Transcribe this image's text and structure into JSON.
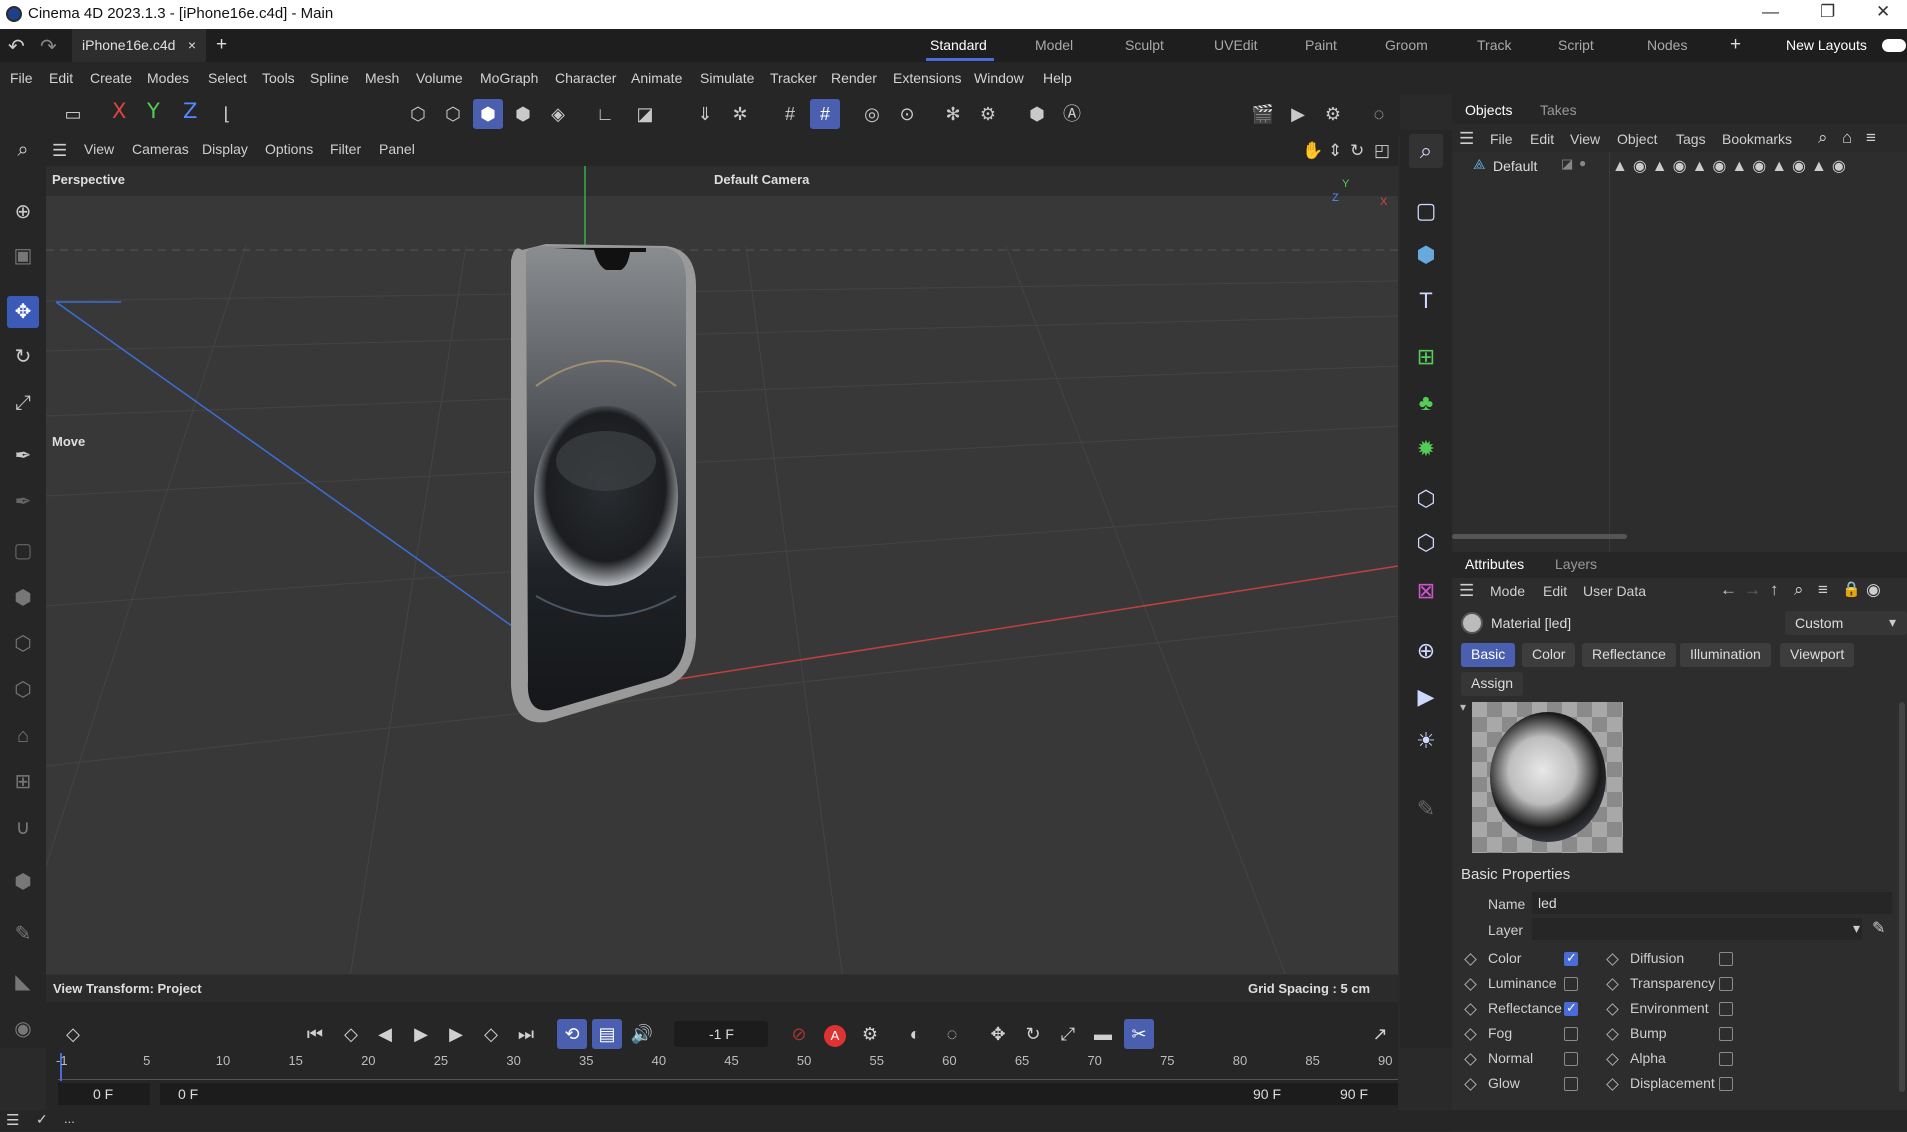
{
  "window": {
    "title": "Cinema 4D 2023.1.3 - [iPhone16e.c4d] - Main"
  },
  "doc_tab": {
    "name": "iPhone16e.c4d",
    "close": "×",
    "add": "+"
  },
  "layouts": {
    "items": [
      "Standard",
      "Model",
      "Sculpt",
      "UVEdit",
      "Paint",
      "Groom",
      "Track",
      "Script",
      "Nodes"
    ],
    "add": "+",
    "new_layouts": "New Layouts",
    "active": "Standard"
  },
  "menus": [
    "File",
    "Edit",
    "Create",
    "Modes",
    "Select",
    "Tools",
    "Spline",
    "Mesh",
    "Volume",
    "MoGraph",
    "Character",
    "Animate",
    "Simulate",
    "Tracker",
    "Render",
    "Extensions",
    "Window",
    "Help"
  ],
  "axis_buttons": [
    "X",
    "Y",
    "Z"
  ],
  "viewport": {
    "menu": [
      "View",
      "Cameras",
      "Display",
      "Options",
      "Filter",
      "Panel"
    ],
    "label": "Perspective",
    "camera": "Default Camera",
    "tool_hint": "Move",
    "view_transform": "View Transform: Project",
    "grid_spacing": "Grid Spacing : 5 cm"
  },
  "objects_panel": {
    "tabs": [
      "Objects",
      "Takes"
    ],
    "menu": [
      "File",
      "Edit",
      "View",
      "Object",
      "Tags",
      "Bookmarks"
    ],
    "items": [
      {
        "name": "Default"
      }
    ]
  },
  "attributes_panel": {
    "tabs": [
      "Attributes",
      "Layers"
    ],
    "menu": [
      "Mode",
      "Edit",
      "User Data"
    ],
    "header": "Material [led]",
    "preset": "Custom",
    "channels": [
      "Basic",
      "Color",
      "Reflectance",
      "Illumination",
      "Viewport"
    ],
    "assign": "Assign",
    "section": "Basic Properties",
    "name_label": "Name",
    "name_value": "led",
    "layer_label": "Layer",
    "properties_left": [
      {
        "label": "Color",
        "checked": true
      },
      {
        "label": "Luminance",
        "checked": false
      },
      {
        "label": "Reflectance",
        "checked": true
      },
      {
        "label": "Fog",
        "checked": false
      },
      {
        "label": "Normal",
        "checked": false
      },
      {
        "label": "Glow",
        "checked": false
      }
    ],
    "properties_right": [
      {
        "label": "Diffusion",
        "checked": false
      },
      {
        "label": "Transparency",
        "checked": false
      },
      {
        "label": "Environment",
        "checked": false
      },
      {
        "label": "Bump",
        "checked": false
      },
      {
        "label": "Alpha",
        "checked": false
      },
      {
        "label": "Displacement",
        "checked": false
      }
    ]
  },
  "timeline": {
    "current_frame": "-1 F",
    "ticks": [
      "-1",
      "5",
      "10",
      "15",
      "20",
      "25",
      "30",
      "35",
      "40",
      "45",
      "50",
      "55",
      "60",
      "65",
      "70",
      "75",
      "80",
      "85",
      "90"
    ],
    "range_start": "0 F",
    "range_inner_start": "0 F",
    "range_inner_end": "90 F",
    "range_end": "90 F"
  },
  "statusbar": {
    "text": "..."
  },
  "colors": {
    "accent": "#4a5fb0",
    "x_axis": "#c04040",
    "y_axis": "#35b04a",
    "z_axis": "#3b6ed6"
  }
}
